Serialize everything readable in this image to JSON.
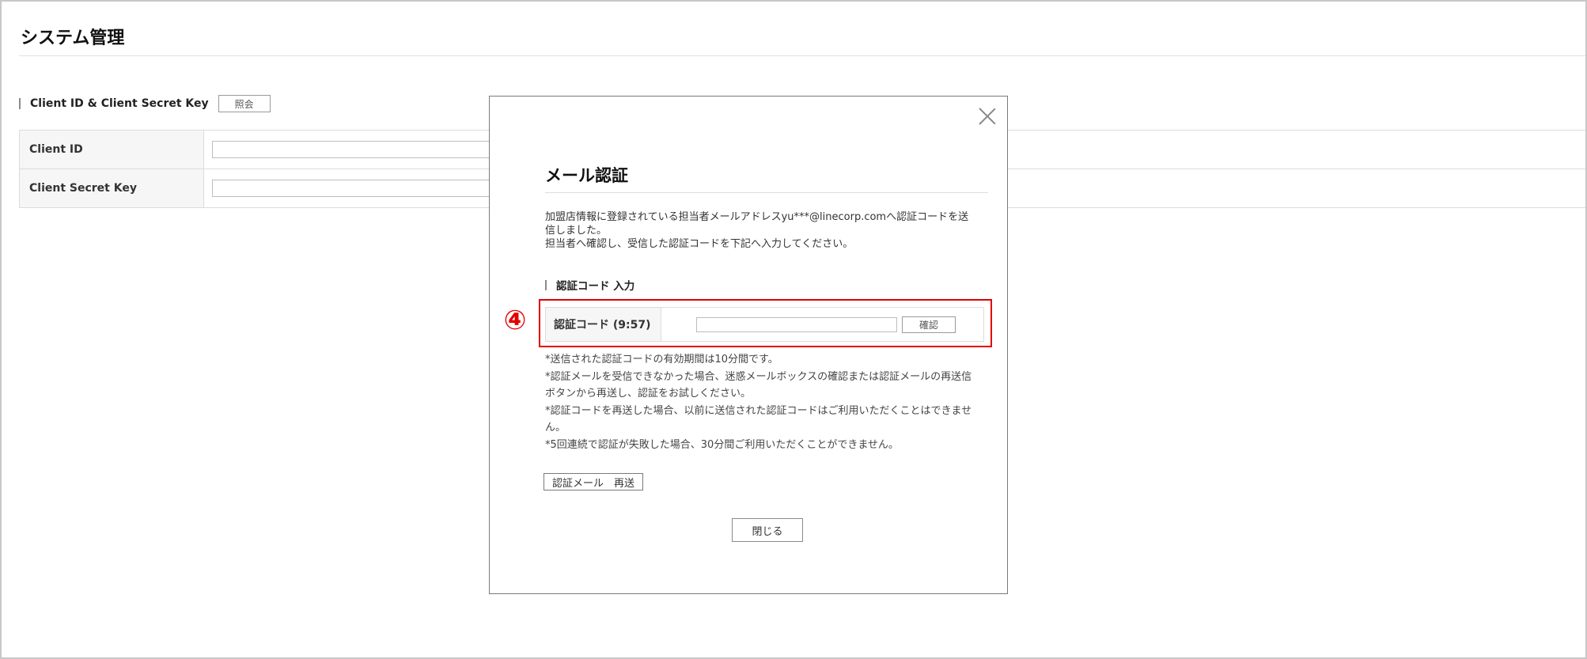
{
  "page": {
    "title": "システム管理",
    "section_label": "Client ID & Client Secret Key",
    "lookup_button": "照会",
    "rows": [
      {
        "label": "Client ID",
        "value": ""
      },
      {
        "label": "Client Secret Key",
        "value": ""
      }
    ]
  },
  "modal": {
    "title": "メール認証",
    "description": [
      "加盟店情報に登録されている担当者メールアドレスyu***@linecorp.comへ認証コードを送",
      "信しました。",
      "担当者へ確認し、受信した認証コードを下記へ入力してください。"
    ],
    "subsection_label": "認証コード 入力",
    "marker": "④",
    "code_label": "認証コード (9:57)",
    "code_value": "",
    "confirm_button": "確認",
    "notes": [
      "*送信された認証コードの有効期間は10分間です。",
      "*認証メールを受信できなかった場合、迷惑メールボックスの確認または認証メールの再送信",
      "ボタンから再送し、認証をお試しください。",
      "*認証コードを再送した場合、以前に送信された認証コードはご利用いただくことはできませ",
      "ん。",
      "*5回連続で認証が失敗した場合、30分間ご利用いただくことができません。"
    ],
    "resend_button": "認証メール　再送",
    "close_button": "閉じる"
  },
  "colors": {
    "highlight": "#e30000",
    "border": "#dcdcdc",
    "label_bg": "#f6f6f6"
  }
}
